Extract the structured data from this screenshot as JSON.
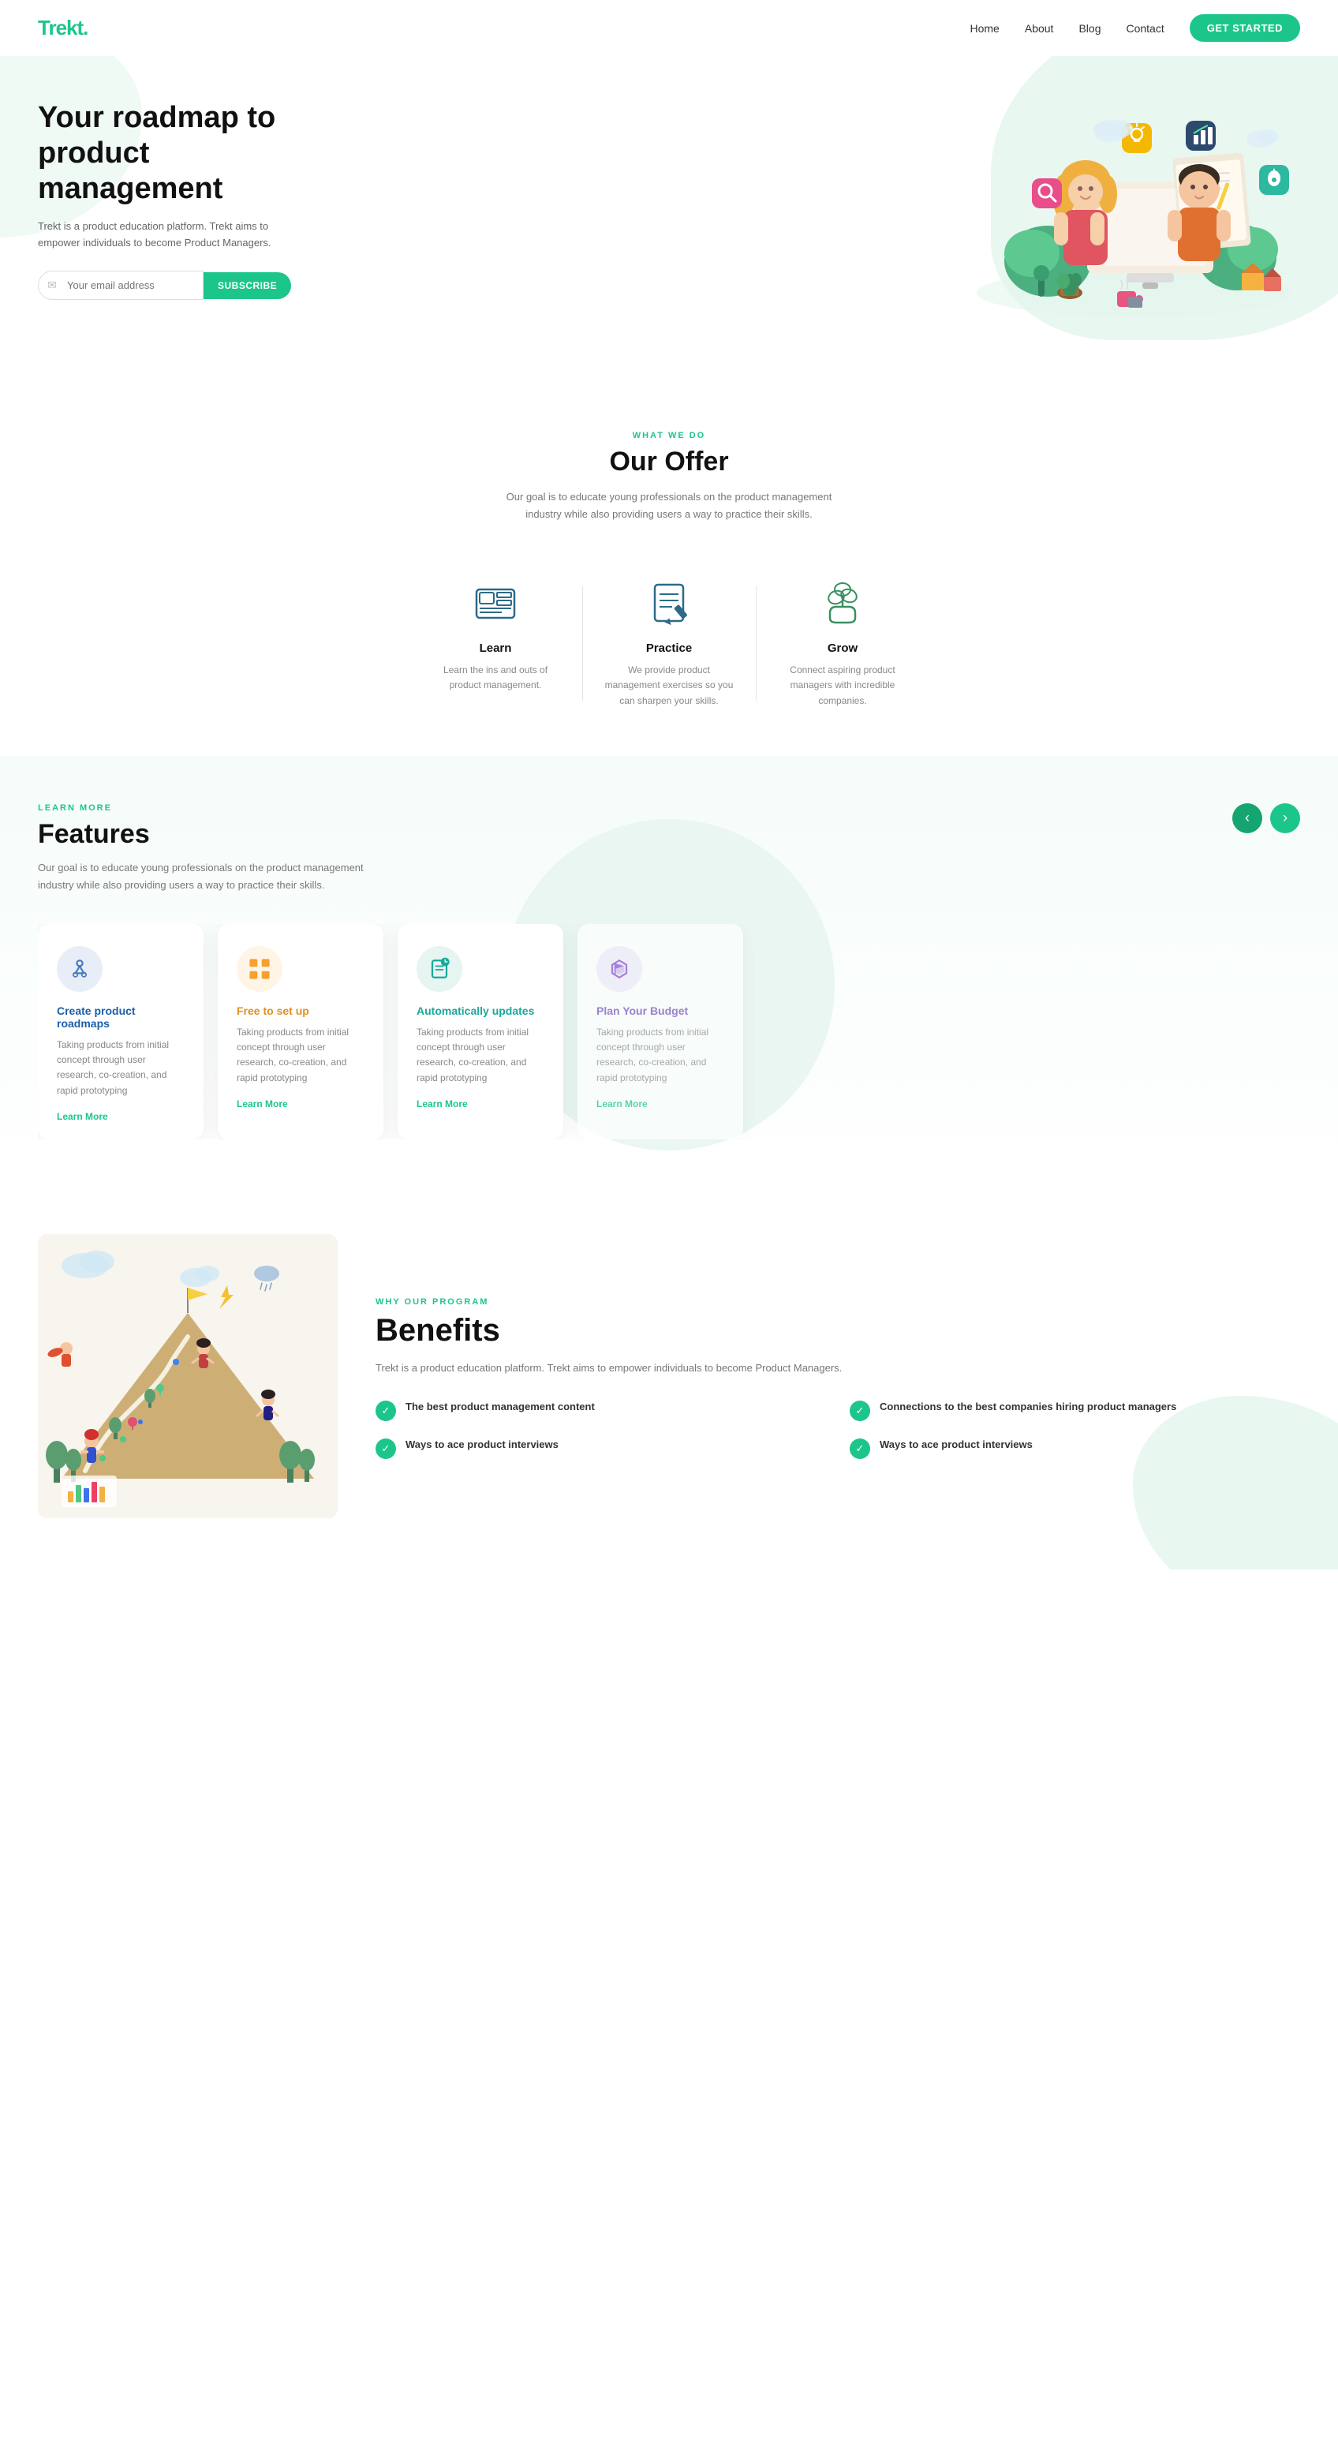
{
  "nav": {
    "logo": "Trekt.",
    "links": [
      {
        "label": "Home",
        "href": "#"
      },
      {
        "label": "About",
        "href": "#"
      },
      {
        "label": "Blog",
        "href": "#"
      },
      {
        "label": "Contact",
        "href": "#"
      }
    ],
    "cta_label": "GET STARTED"
  },
  "hero": {
    "title": "Your roadmap to product management",
    "subtitle": "Trekt is a product education platform. Trekt aims to empower individuals to become Product Managers.",
    "input_placeholder": "Your email address",
    "subscribe_label": "SUBSCRIBE"
  },
  "offer": {
    "section_label": "WHAT WE DO",
    "title": "Our Offer",
    "subtitle": "Our goal is to educate young professionals on the product management industry while also providing users a way to practice their skills.",
    "cards": [
      {
        "icon": "learn-icon",
        "title": "Learn",
        "desc": "Learn the ins and outs of product management."
      },
      {
        "icon": "practice-icon",
        "title": "Practice",
        "desc": "We provide product management exercises so you can sharpen your skills."
      },
      {
        "icon": "grow-icon",
        "title": "Grow",
        "desc": "Connect aspiring product managers with incredible companies."
      }
    ]
  },
  "features": {
    "section_label": "LEARN MORE",
    "title": "Features",
    "subtitle": "Our goal is to educate young professionals on the product management industry while also providing users a way to practice their skills.",
    "prev_label": "‹",
    "next_label": "›",
    "cards": [
      {
        "icon": "roadmap-icon",
        "color": "blue",
        "title": "Create product roadmaps",
        "desc": "Taking products from initial concept through user research, co-creation, and rapid prototyping",
        "learn_more": "Learn More"
      },
      {
        "icon": "setup-icon",
        "color": "orange",
        "title": "Free to set up",
        "desc": "Taking products from initial concept through user research, co-creation, and rapid prototyping",
        "learn_more": "Learn More"
      },
      {
        "icon": "update-icon",
        "color": "teal",
        "title": "Automatically updates",
        "desc": "Taking products from initial concept through user research, co-creation, and rapid prototyping",
        "learn_more": "Learn More"
      },
      {
        "icon": "plan-icon",
        "color": "purple",
        "title": "Plan Your Budget",
        "desc": "Taking products from initial concept through user research, co-creation, and rapid prototyping",
        "learn_more": "Learn More"
      }
    ]
  },
  "benefits": {
    "section_label": "WHY OUR PROGRAM",
    "title": "Benefits",
    "desc": "Trekt is a product education platform. Trekt aims to empower individuals to become Product Managers.",
    "items": [
      {
        "text": "The best product management content"
      },
      {
        "text": "Connections to the best companies hiring product managers"
      },
      {
        "text": "Ways to ace product interviews"
      },
      {
        "text": "Ways to ace product interviews"
      }
    ]
  }
}
